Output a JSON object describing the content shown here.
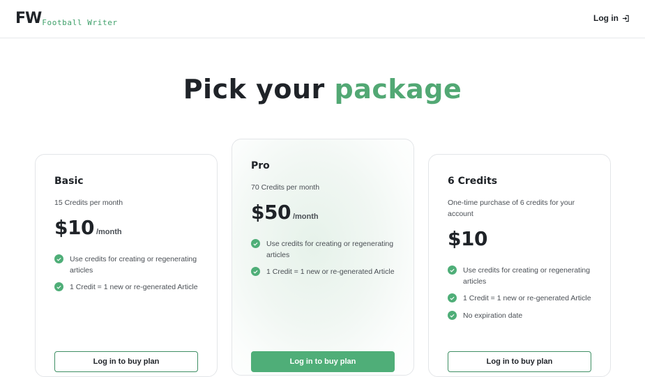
{
  "header": {
    "logo_mark": "FW",
    "logo_text": "Football Writer",
    "login_label": "Log in"
  },
  "hero": {
    "title_main": "Pick your",
    "title_accent": "package"
  },
  "plans": [
    {
      "name": "Basic",
      "subtitle": "15 Credits per month",
      "price": "$10",
      "period": "/month",
      "features": [
        "Use credits for creating or regenerating articles",
        "1 Credit = 1 new or re-generated Article"
      ],
      "button": "Log in to buy plan"
    },
    {
      "name": "Pro",
      "subtitle": "70 Credits per month",
      "price": "$50",
      "period": "/month",
      "features": [
        "Use credits for creating or regenerating articles",
        "1 Credit = 1 new or re-generated Article"
      ],
      "button": "Log in to buy plan"
    },
    {
      "name": "6 Credits",
      "subtitle": "One-time purchase of 6 credits for your account",
      "price": "$10",
      "period": "",
      "features": [
        "Use credits for creating or regenerating articles",
        "1 Credit = 1 new or re-generated Article",
        "No expiration date"
      ],
      "button": "Log in to buy plan"
    }
  ],
  "colors": {
    "accent": "#52a874",
    "check": "#4fae78",
    "text": "#1f2328"
  },
  "icons": {
    "login": "login-arrow-icon",
    "feature": "check-circle-icon"
  }
}
